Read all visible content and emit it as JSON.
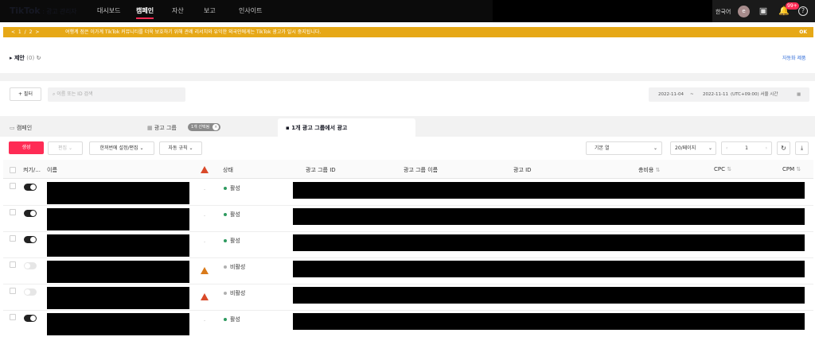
{
  "header": {
    "logo": "TikTok",
    "logo_sub": ": 광고 관리자",
    "nav": [
      {
        "label": "대시보드"
      },
      {
        "label": "캠페인"
      },
      {
        "label": "자산"
      },
      {
        "label": "보고"
      },
      {
        "label": "인사이트"
      }
    ],
    "language": "한국어",
    "avatar_initial": "e",
    "notification_count": "99+"
  },
  "notice": {
    "pager": "<  1 / 2  >",
    "message": "여행계 점은 이가계 TikTok 커뮤니티를 더욱 보호하기 위해 관례 리서치와 유익한 외국인에게는 TikTok 광고가 일시 중지됩니다.",
    "ok_label": "OK"
  },
  "campaign_section": {
    "title": "제안",
    "count": "(0)",
    "link": "자동화 제품"
  },
  "filter": {
    "button_label": "+ 필터",
    "search_placeholder": "이름 또는 ID 검색",
    "date_start": "2022-11-04",
    "date_end": "2022-11-11",
    "timezone": "(UTC+09:00) 서울 시간"
  },
  "tabs": {
    "campaign": "캠페인",
    "adgroup": "광고 그룹",
    "adgroup_tag": "1개 선택됨",
    "ad": "1개 광고 그룹에서 광고"
  },
  "toolbar": {
    "create": "생성",
    "edit": "편집",
    "bulk_edit": "한꺼번에 설정/편집",
    "auto_rule": "자동 규칙",
    "column_view": "기본 열",
    "per_page": "20/페이지",
    "page": "1"
  },
  "table": {
    "columns": {
      "onoff": "켜기/...",
      "name": "이름",
      "status": "상태",
      "adgroup_id": "광고 그룹 ID",
      "adgroup_name": "광고 그룹 이름",
      "ad_id": "광고 ID",
      "total_cost": "총비용",
      "cpc": "CPC",
      "cpm": "CPM"
    },
    "rows": [
      {
        "on": true,
        "warning": false,
        "dash": "-",
        "status": "활성"
      },
      {
        "on": true,
        "warning": false,
        "dash": "-",
        "status": "활성"
      },
      {
        "on": true,
        "warning": false,
        "dash": "-",
        "status": "활성"
      },
      {
        "on": false,
        "warning": true,
        "dash": "",
        "status": "비활성"
      },
      {
        "on": false,
        "warning": true,
        "dash": "",
        "status": "비활성"
      },
      {
        "on": true,
        "warning": false,
        "dash": "-",
        "status": "활성"
      }
    ]
  },
  "colors": {
    "brand_red": "#fe2c55",
    "notice_yellow": "#e6a817",
    "active_green": "#2e9a5f",
    "inactive_gray": "#b0b0b0"
  }
}
